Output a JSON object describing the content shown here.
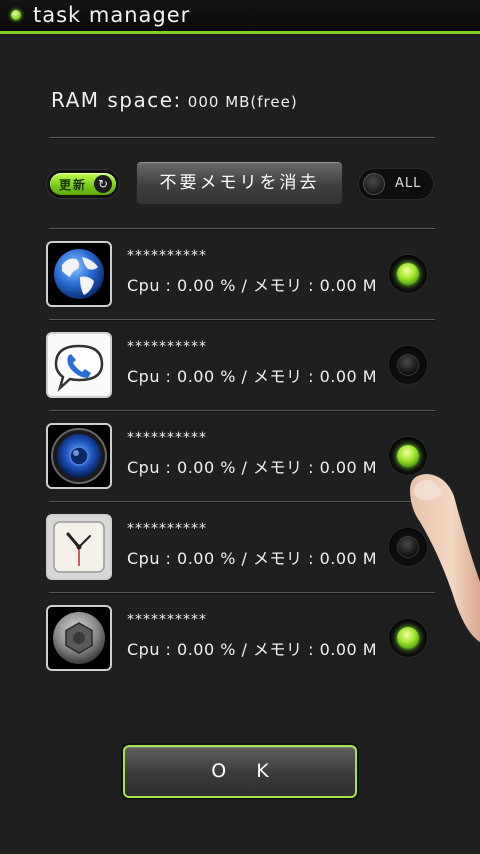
{
  "app": {
    "title": "task manager"
  },
  "ram": {
    "label": "RAM space:",
    "value": "000 MB(free)"
  },
  "controls": {
    "refresh_label": "更新",
    "refresh_icon": "refresh-icon",
    "clear_memory_label": "不要メモリを消去",
    "all_label": "ALL",
    "all_enabled": false
  },
  "tasks": [
    {
      "name": "**********",
      "stats": "Cpu : 0.00 % / メモリ : 0.00 M",
      "icon": "globe-icon",
      "selected": true
    },
    {
      "name": "**********",
      "stats": "Cpu : 0.00 % / メモリ : 0.00 M",
      "icon": "phone-chat-icon",
      "selected": false
    },
    {
      "name": "**********",
      "stats": "Cpu : 0.00 % / メモリ : 0.00 M",
      "icon": "speaker-icon",
      "selected": true
    },
    {
      "name": "**********",
      "stats": "Cpu : 0.00 % / メモリ : 0.00 M",
      "icon": "clock-icon",
      "selected": false
    },
    {
      "name": "**********",
      "stats": "Cpu : 0.00 % / メモリ : 0.00 M",
      "icon": "bolt-icon",
      "selected": true
    }
  ],
  "ok_label": "OK",
  "colors": {
    "accent": "#8bd82a",
    "background": "#1f1f1f"
  }
}
